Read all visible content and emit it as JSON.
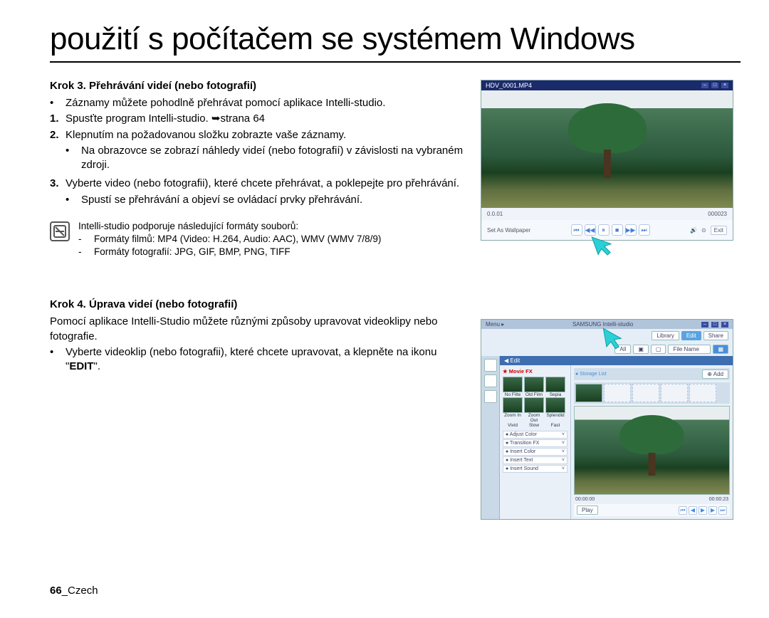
{
  "title": "použití s počítačem se systémem Windows",
  "step3": {
    "heading": "Krok 3. Přehrávání videí (nebo fotografií)",
    "b1": "Záznamy můžete pohodlně přehrávat pomocí aplikace Intelli-studio.",
    "n1": "Spusťte program Intelli-studio. ➥strana 64",
    "n2": "Klepnutím na požadovanou složku zobrazte vaše záznamy.",
    "n2s": "Na obrazovce se zobrazí náhledy videí (nebo fotografií) v závislosti na vybraném zdroji.",
    "n3": "Vyberte video (nebo fotografii), které chcete přehrávat, a poklepejte pro přehrávání.",
    "n3s": "Spustí se přehrávání a objeví se ovládací prvky přehrávání."
  },
  "note": {
    "l0": "Intelli-studio podporuje následující formáty souborů:",
    "l1": "Formáty filmů: MP4 (Video: H.264, Audio: AAC), WMV (WMV 7/8/9)",
    "l2": "Formáty fotografií: JPG, GIF, BMP, PNG, TIFF"
  },
  "step4": {
    "heading": "Krok 4. Úprava videí (nebo fotografií)",
    "p": "Pomocí aplikace Intelli-Studio můžete různými způsoby upravovat videoklipy nebo fotografie.",
    "b1a": "Vyberte videoklip (nebo fotografii), které chcete upravovat, a klepněte na ikonu \"",
    "b1b": "EDIT",
    "b1c": "\"."
  },
  "footer_num": "66",
  "footer_lang": "_Czech",
  "shot1": {
    "filename": "HDV_0001.MP4",
    "time_l": "0.0.01",
    "time_r": "000023",
    "setas": "Set As Wallpaper",
    "exit": "Exit"
  },
  "shot2": {
    "brand": "SAMSUNG Intelli-studio",
    "menu": "Menu ▸",
    "lib": "Library",
    "edit": "Edit",
    "share": "Share",
    "all": "All",
    "filename": "File Name",
    "editbar": "◀ Edit",
    "movie_fx": "★ Movie FX",
    "add": "⊕ Add",
    "fx1": "No Filte",
    "fx2": "Old Film",
    "fx3": "Sepia",
    "fx4": "Zoom In",
    "fx5": "Zoom Out",
    "fx6": "Splendid",
    "fx7": "Vivid",
    "fx8": "Slow",
    "fx9": "Fast",
    "opt1": "Adjust Color",
    "opt2": "Transition FX",
    "opt3": "Insert Color",
    "opt4": "Insert Text",
    "opt5": "Insert Sound",
    "t0": "00:00:00",
    "t1": "00:00:23",
    "play": "Play"
  }
}
